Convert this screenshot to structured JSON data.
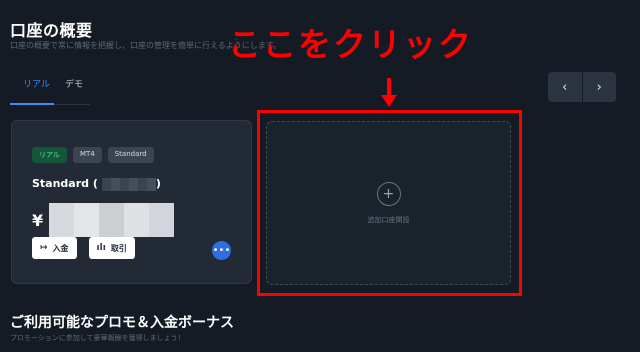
{
  "header": {
    "title": "口座の概要",
    "subtitle": "口座の概要で常に情報を把握し、口座の管理を簡単に行えるようにします。"
  },
  "tabs": [
    {
      "label": "リアル",
      "active": true
    },
    {
      "label": "デモ",
      "active": false
    }
  ],
  "nav": {
    "prev_icon": "‹",
    "next_icon": "›"
  },
  "account_card": {
    "badges": [
      "リアル",
      "MT4",
      "Standard"
    ],
    "name_prefix": "Standard (",
    "name_suffix": ")",
    "currency_symbol": "¥",
    "deposit_label": "入金",
    "deposit_icon": "↦",
    "trade_label": "取引",
    "trade_icon": "ılı",
    "more_icon": "•••"
  },
  "add_account": {
    "plus_icon": "+",
    "label": "追加口座開設"
  },
  "annotation": {
    "text": "ここをクリック",
    "color": "#ff0000"
  },
  "promo": {
    "title": "ご利用可能なプロモ＆入金ボーナス",
    "subtitle": "プロモーションに参加して豪華報酬を獲得しましょう！"
  },
  "colors": {
    "background": "#141b24",
    "accent": "#3d8bfd",
    "badge_real": "#16553a"
  }
}
